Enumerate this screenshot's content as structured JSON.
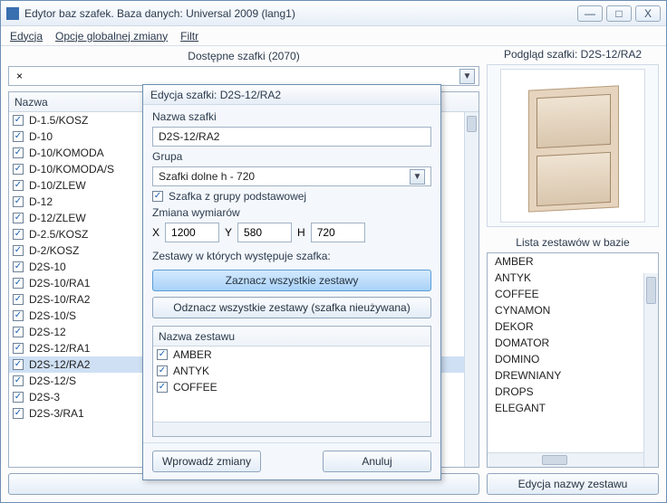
{
  "window": {
    "title": "Edytor baz szafek. Baza danych: Universal 2009 (lang1)",
    "controls": {
      "min": "—",
      "max": "□",
      "close": "X"
    }
  },
  "menu": {
    "edit": "Edycja",
    "global": "Opcje globalnej zmiany",
    "filter": "Filtr"
  },
  "left": {
    "header": "Dostępne szafki (2070)",
    "combo_value": "×",
    "th_name": "Nazwa",
    "rows": [
      "D-1.5/KOSZ",
      "D-10",
      "D-10/KOMODA",
      "D-10/KOMODA/S",
      "D-10/ZLEW",
      "D-12",
      "D-12/ZLEW",
      "D-2.5/KOSZ",
      "D-2/KOSZ",
      "D2S-10",
      "D2S-10/RA1",
      "D2S-10/RA2",
      "D2S-10/S",
      "D2S-12",
      "D2S-12/RA1",
      "D2S-12/RA2",
      "D2S-12/S",
      "D2S-3",
      "D2S-3/RA1"
    ],
    "selected_index": 15,
    "bottom_btn": " "
  },
  "right": {
    "preview_title": "Podgląd szafki: D2S-12/RA2",
    "list_title": "Lista zestawów w bazie",
    "sets": [
      "AMBER",
      "ANTYK",
      "COFFEE",
      "CYNAMON",
      "DEKOR",
      "DOMATOR",
      "DOMINO",
      "DREWNIANY",
      "DROPS",
      "ELEGANT"
    ],
    "edit_set_btn": "Edycja nazwy zestawu"
  },
  "dialog": {
    "title": "Edycja szafki: D2S-12/RA2",
    "lbl_name": "Nazwa szafki",
    "name_value": "D2S-12/RA2",
    "lbl_group": "Grupa",
    "group_value": "Szafki dolne h - 720",
    "chk_basic": "Szafka z grupy podstawowej",
    "lbl_dim": "Zmiana wymiarów",
    "dim_x_label": "X",
    "dim_x": "1200",
    "dim_y_label": "Y",
    "dim_y": "580",
    "dim_h_label": "H",
    "dim_h": "720",
    "lbl_sets": "Zestawy w których występuje szafka:",
    "btn_select_all": "Zaznacz wszystkie zestawy",
    "btn_deselect_all": "Odznacz wszystkie zestawy (szafka nieużywana)",
    "th_set": "Nazwa zestawu",
    "set_rows": [
      "AMBER",
      "ANTYK",
      "COFFEE"
    ],
    "btn_apply": "Wprowadź zmiany",
    "btn_cancel": "Anuluj"
  }
}
